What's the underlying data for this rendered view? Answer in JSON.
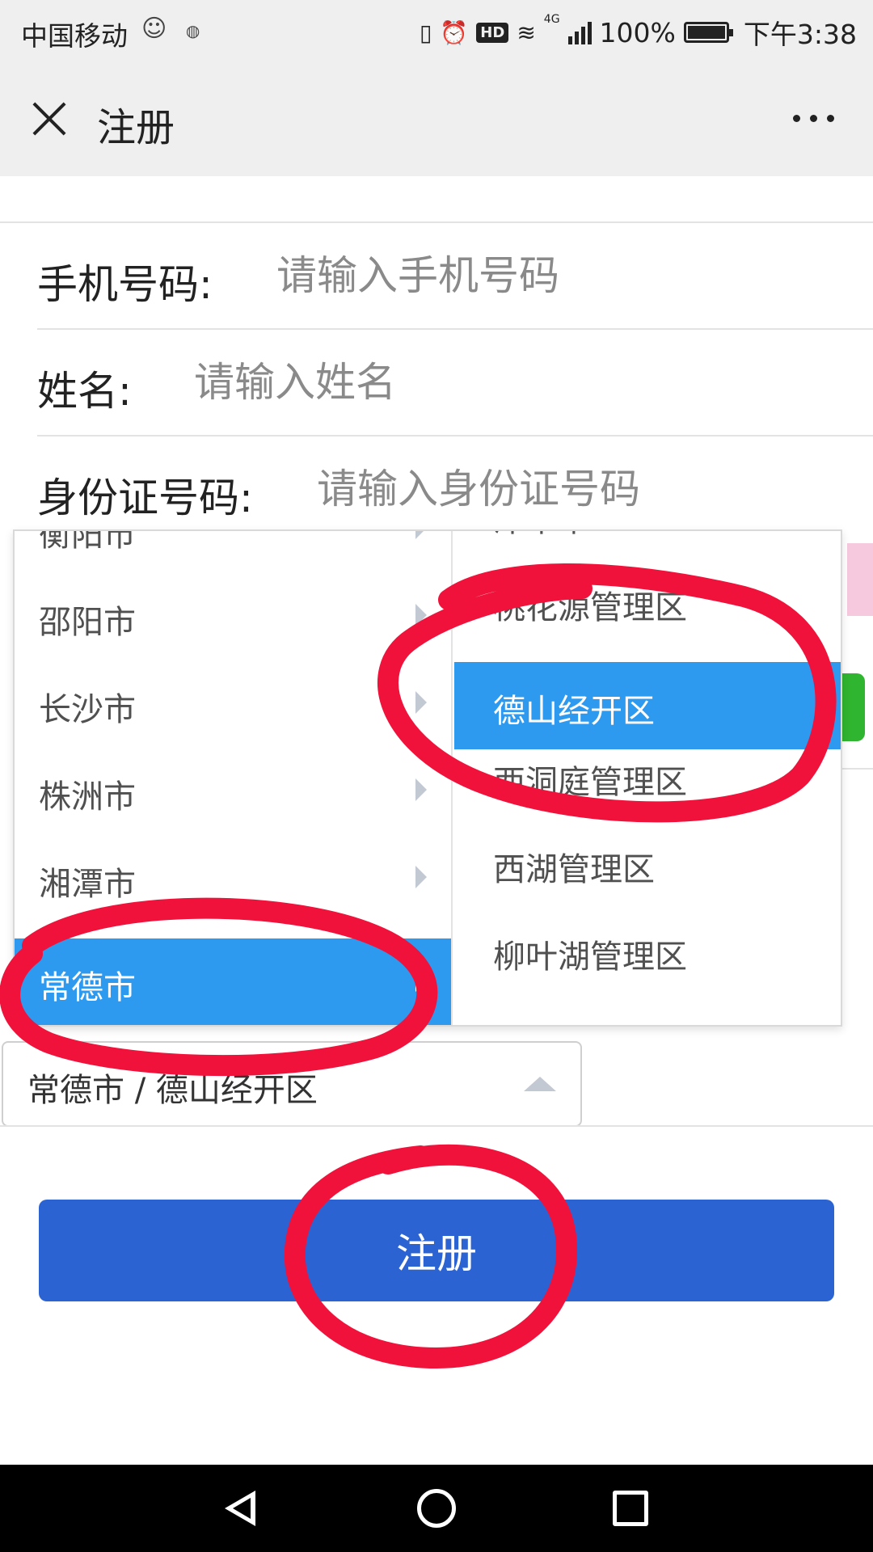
{
  "status_bar": {
    "carrier": "中国移动",
    "network": "4G",
    "battery_level": "100%",
    "time": "下午3:38",
    "icons": [
      "face-icon",
      "vibrate-icon",
      "alarm-icon",
      "hd-icon",
      "wifi-icon",
      "signal-icon",
      "battery-icon"
    ],
    "hd_badge": "HD"
  },
  "header": {
    "title": "注册",
    "close_icon": "close-icon",
    "more_icon": "more-icon"
  },
  "form": {
    "phone": {
      "label": "手机号码:",
      "placeholder": "请输入手机号码"
    },
    "name": {
      "label": "姓名:",
      "placeholder": "请输入姓名"
    },
    "id_number": {
      "label": "身份证号码:",
      "placeholder": "请输入身份证号码"
    },
    "region_select": {
      "value": "常德市 / 德山经开区"
    }
  },
  "cascader": {
    "cities": [
      {
        "label": "衡阳市",
        "selected": false
      },
      {
        "label": "邵阳市",
        "selected": false
      },
      {
        "label": "长沙市",
        "selected": false
      },
      {
        "label": "株洲市",
        "selected": false
      },
      {
        "label": "湘潭市",
        "selected": false
      },
      {
        "label": "常德市",
        "selected": true
      }
    ],
    "districts": [
      {
        "label": "津市市",
        "selected": false
      },
      {
        "label": "桃花源管理区",
        "selected": false
      },
      {
        "label": "德山经开区",
        "selected": true
      },
      {
        "label": "西洞庭管理区",
        "selected": false
      },
      {
        "label": "西湖管理区",
        "selected": false
      },
      {
        "label": "柳叶湖管理区",
        "selected": false
      }
    ]
  },
  "submit_button": {
    "label": "注册"
  },
  "colors": {
    "accent_blue": "#2c63d3",
    "selected_option": "#2d9af0",
    "annotation_red": "#f0123a"
  },
  "nav_bar": {
    "icons": [
      "back-icon",
      "home-icon",
      "recent-apps-icon"
    ]
  }
}
